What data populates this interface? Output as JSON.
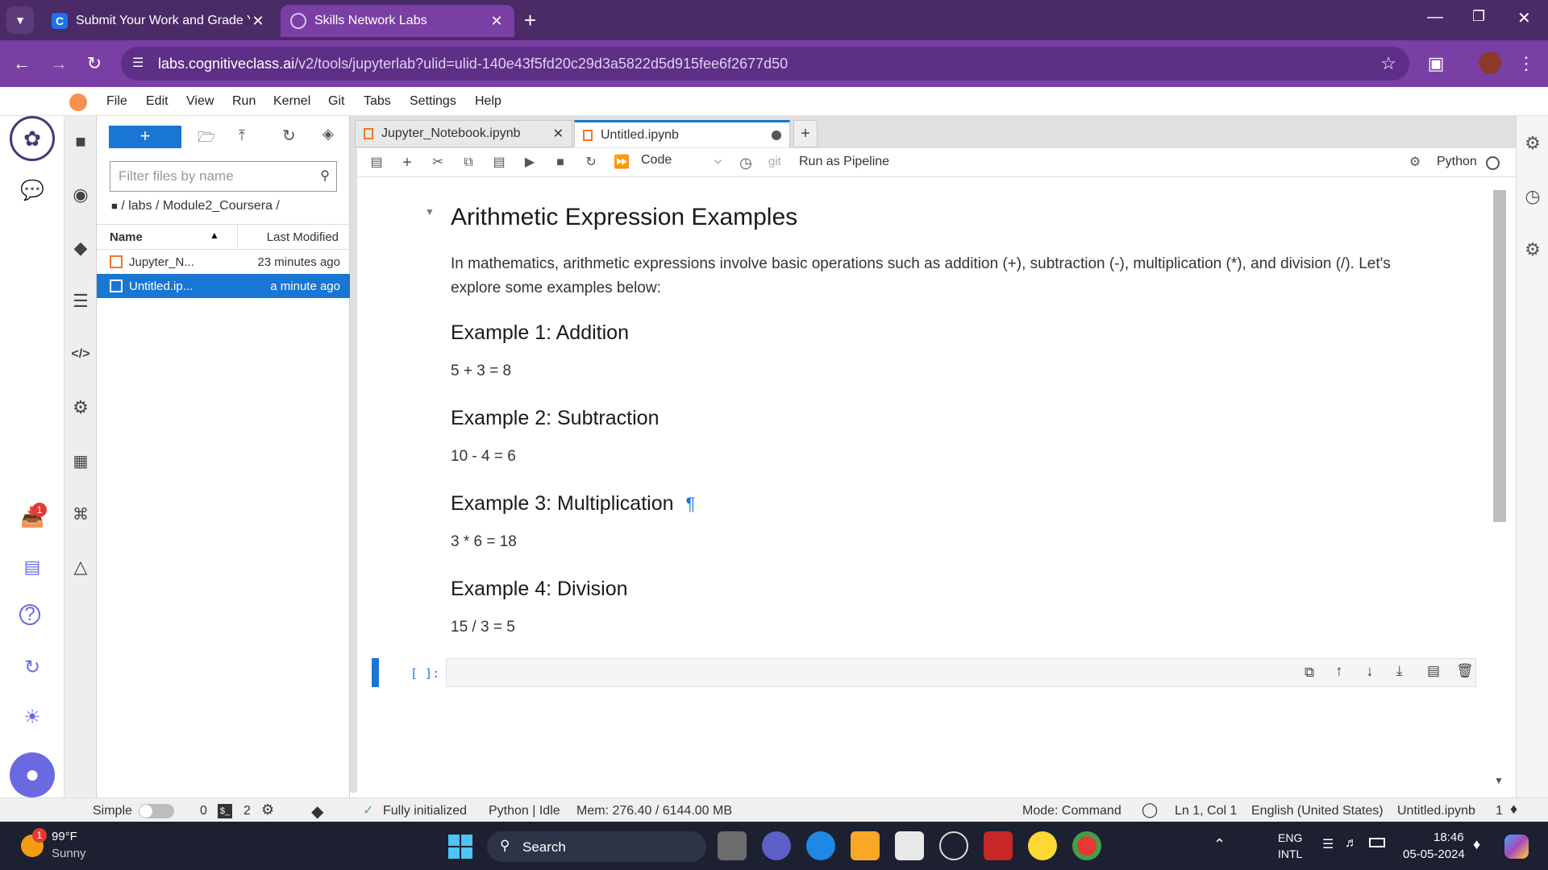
{
  "browser": {
    "tabs": [
      {
        "title": "Submit Your Work and Grade Yo",
        "icon": "coursera-c-icon"
      },
      {
        "title": "Skills Network Labs",
        "icon": "globe-icon"
      }
    ],
    "url_domain": "labs.cognitiveclass.ai",
    "url_path": "/v2/tools/jupyterlab?ulid=ulid-140e43f5fd20c29d3a5822d5d915fee6f2677d50",
    "theme_color": "#4a2a67"
  },
  "menubar": {
    "items": [
      "File",
      "Edit",
      "View",
      "Run",
      "Kernel",
      "Git",
      "Tabs",
      "Settings",
      "Help"
    ]
  },
  "filebrowser": {
    "filter_placeholder": "Filter files by name",
    "breadcrumb": "/ labs / Module2_Coursera /",
    "col_name": "Name",
    "col_modified": "Last Modified",
    "files": [
      {
        "name": "Jupyter_N...",
        "modified": "23 minutes ago",
        "selected": false
      },
      {
        "name": "Untitled.ip...",
        "modified": "a minute ago",
        "selected": true
      }
    ]
  },
  "doctabs": [
    {
      "title": "Jupyter_Notebook.ipynb",
      "active": false
    },
    {
      "title": "Untitled.ipynb",
      "active": true
    }
  ],
  "nbtoolbar": {
    "cell_type": "Code",
    "git": "git",
    "pipeline": "Run as Pipeline",
    "kernel": "Python"
  },
  "notebook": {
    "title": "Arithmetic Expression Examples",
    "intro_line1": "In mathematics, arithmetic expressions involve basic operations such as addition (+), subtraction (-), multiplication (*), and division (/). Let's",
    "intro_line2": "explore some examples below:",
    "examples": [
      {
        "heading": "Example 1: Addition",
        "expr": "5 + 3 = 8"
      },
      {
        "heading": "Example 2: Subtraction",
        "expr": "10 - 4 = 6"
      },
      {
        "heading": "Example 3: Multiplication",
        "expr": "3 * 6 = 18"
      },
      {
        "heading": "Example 4: Division",
        "expr": "15 / 3 = 5"
      }
    ],
    "pilcrow": "¶",
    "prompt": "[ ]:"
  },
  "statusbar": {
    "mode_label": "Simple",
    "terminals": "0",
    "kernels": "2",
    "init": "Fully initialized",
    "kernel_status": "Python | Idle",
    "mem": "Mem: 276.40 / 6144.00 MB",
    "mode": "Mode: Command",
    "cursor": "Ln 1, Col 1",
    "lang": "English (United States)",
    "file": "Untitled.ipynb",
    "notif_count": "1"
  },
  "taskbar": {
    "temp": "99°F",
    "weather": "Sunny",
    "weather_badge": "1",
    "search": "Search",
    "lang1": "ENG",
    "lang2": "INTL",
    "time": "18:46",
    "date": "05-05-2024"
  },
  "sidebar_badge": "1"
}
